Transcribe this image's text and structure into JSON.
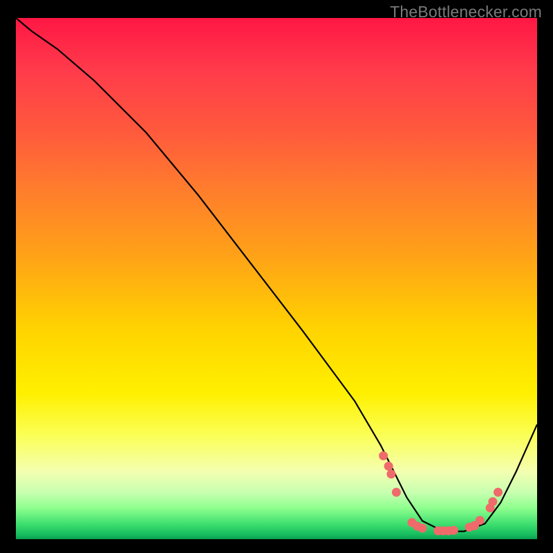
{
  "watermark": "TheBottlenecker.com",
  "colors": {
    "curve": "#000000",
    "marker_fill": "#ef6a6a",
    "marker_stroke": "#ef6a6a",
    "page_bg": "#000000"
  },
  "chart_data": {
    "type": "line",
    "title": "",
    "xlabel": "",
    "ylabel": "",
    "xlim": [
      0,
      100
    ],
    "ylim": [
      0,
      100
    ],
    "x": [
      0,
      3,
      8,
      15,
      25,
      35,
      45,
      55,
      65,
      70,
      72,
      75,
      78,
      82,
      86,
      90,
      93,
      96,
      100
    ],
    "values": [
      100,
      97.5,
      94,
      88,
      78,
      66,
      53,
      40,
      26.5,
      18,
      14,
      8,
      3.5,
      1.5,
      1.5,
      3,
      7,
      13,
      22
    ],
    "markers": {
      "x": [
        70.5,
        71.5,
        72,
        73,
        76,
        77,
        78,
        81,
        82,
        83,
        84,
        87,
        88,
        89,
        91,
        91.5,
        92.5
      ],
      "values": [
        16,
        14,
        12.5,
        9,
        3.2,
        2.5,
        2.1,
        1.6,
        1.6,
        1.6,
        1.7,
        2.3,
        2.6,
        3.6,
        6,
        7.2,
        9
      ]
    }
  }
}
